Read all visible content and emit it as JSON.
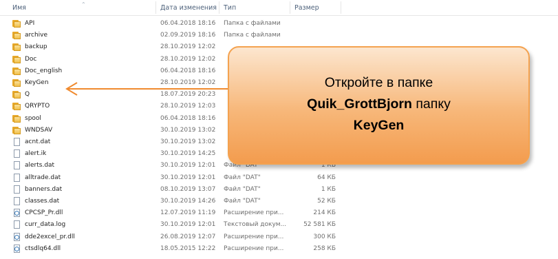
{
  "columns": {
    "name": "Имя",
    "date": "Дата изменения",
    "type": "Тип",
    "size": "Размер"
  },
  "rows": [
    {
      "name": "API",
      "date": "06.04.2018 18:16",
      "type": "Папка с файлами",
      "size": "",
      "icon": "folder-icon"
    },
    {
      "name": "archive",
      "date": "02.09.2019 18:16",
      "type": "Папка с файлами",
      "size": "",
      "icon": "folder-icon"
    },
    {
      "name": "backup",
      "date": "28.10.2019 12:02",
      "type": "",
      "size": "",
      "icon": "folder-icon"
    },
    {
      "name": "Doc",
      "date": "28.10.2019 12:02",
      "type": "",
      "size": "",
      "icon": "folder-icon"
    },
    {
      "name": "Doc_english",
      "date": "06.04.2018 18:16",
      "type": "",
      "size": "",
      "icon": "folder-icon"
    },
    {
      "name": "KeyGen",
      "date": "28.10.2019 12:02",
      "type": "",
      "size": "",
      "icon": "folder-icon"
    },
    {
      "name": "Q",
      "date": "18.07.2019 20:23",
      "type": "",
      "size": "",
      "icon": "folder-icon"
    },
    {
      "name": "QRYPTO",
      "date": "28.10.2019 12:03",
      "type": "",
      "size": "",
      "icon": "folder-icon"
    },
    {
      "name": "spool",
      "date": "06.04.2018 18:16",
      "type": "",
      "size": "",
      "icon": "folder-icon"
    },
    {
      "name": "WNDSAV",
      "date": "30.10.2019 13:02",
      "type": "",
      "size": "",
      "icon": "folder-icon"
    },
    {
      "name": "acnt.dat",
      "date": "30.10.2019 13:02",
      "type": "",
      "size": "",
      "icon": "file-icon"
    },
    {
      "name": "alert.ik",
      "date": "30.10.2019 14:25",
      "type": "",
      "size": "",
      "icon": "file-icon"
    },
    {
      "name": "alerts.dat",
      "date": "30.10.2019 12:01",
      "type": "Файл \"DAT\"",
      "size": "1 КБ",
      "icon": "file-icon"
    },
    {
      "name": "alltrade.dat",
      "date": "30.10.2019 12:01",
      "type": "Файл \"DAT\"",
      "size": "64 КБ",
      "icon": "file-icon"
    },
    {
      "name": "banners.dat",
      "date": "08.10.2019 13:07",
      "type": "Файл \"DAT\"",
      "size": "1 КБ",
      "icon": "file-icon"
    },
    {
      "name": "classes.dat",
      "date": "30.10.2019 14:26",
      "type": "Файл \"DAT\"",
      "size": "52 КБ",
      "icon": "file-icon"
    },
    {
      "name": "CPCSP_Pr.dll",
      "date": "12.07.2019 11:19",
      "type": "Расширение при...",
      "size": "214 КБ",
      "icon": "dll-icon"
    },
    {
      "name": "curr_data.log",
      "date": "30.10.2019 12:01",
      "type": "Текстовый докум...",
      "size": "52 581 КБ",
      "icon": "file-icon"
    },
    {
      "name": "dde2excel_pr.dll",
      "date": "26.08.2019 12:07",
      "type": "Расширение при...",
      "size": "300 КБ",
      "icon": "dll-icon"
    },
    {
      "name": "ctsdlq64.dll",
      "date": "18.05.2015 12:22",
      "type": "Расширение при...",
      "size": "258 КБ",
      "icon": "dll-icon"
    }
  ],
  "callout": {
    "line1": "Откройте в папке",
    "line2_bold": "Quik_GrottBjorn",
    "line2_rest": " папку",
    "line3_bold": "KeyGen"
  },
  "colors": {
    "callout_fill": "#f7b779",
    "callout_border": "#f4a24f",
    "arrow": "#f08a2e",
    "header_text": "#4c607a"
  }
}
